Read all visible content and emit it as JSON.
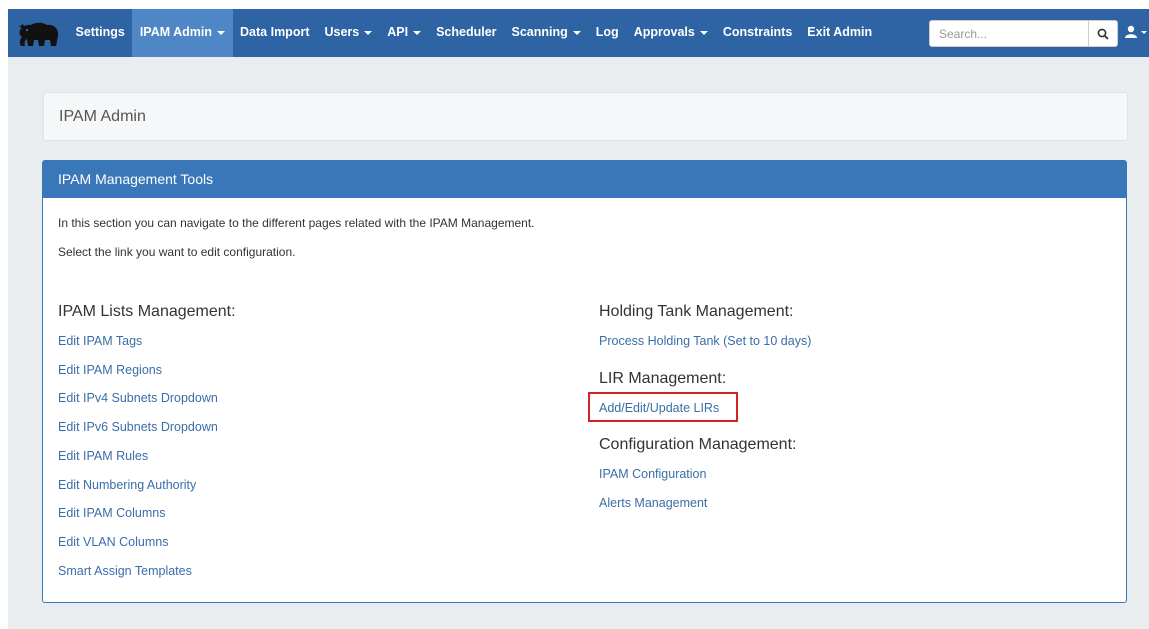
{
  "navbar": {
    "items": [
      {
        "label": "Settings",
        "dropdown": false
      },
      {
        "label": "IPAM Admin",
        "dropdown": true,
        "active": true
      },
      {
        "label": "Data Import",
        "dropdown": false
      },
      {
        "label": "Users",
        "dropdown": true
      },
      {
        "label": "API",
        "dropdown": true
      },
      {
        "label": "Scheduler",
        "dropdown": false
      },
      {
        "label": "Scanning",
        "dropdown": true
      },
      {
        "label": "Log",
        "dropdown": false
      },
      {
        "label": "Approvals",
        "dropdown": true
      },
      {
        "label": "Constraints",
        "dropdown": false
      },
      {
        "label": "Exit Admin",
        "dropdown": false
      }
    ],
    "search_placeholder": "Search...",
    "brand_color": "#2e63a4",
    "active_color": "#4f86c6"
  },
  "breadcrumb": {
    "title": "IPAM Admin"
  },
  "panel": {
    "heading": "IPAM Management Tools",
    "intro_1": "In this section you can navigate to the different pages related with the IPAM Management.",
    "intro_2": "Select the link you want to edit configuration.",
    "left": {
      "title": "IPAM Lists Management:",
      "links": [
        "Edit IPAM Tags",
        "Edit IPAM Regions",
        "Edit IPv4 Subnets Dropdown",
        "Edit IPv6 Subnets Dropdown",
        "Edit IPAM Rules",
        "Edit Numbering Authority",
        "Edit IPAM Columns",
        "Edit VLAN Columns",
        "Smart Assign Templates"
      ]
    },
    "right": {
      "holding_title": "Holding Tank Management:",
      "holding_link": "Process Holding Tank (Set to 10 days)",
      "lir_title": "LIR Management:",
      "lir_link": "Add/Edit/Update LIRs",
      "config_title": "Configuration Management:",
      "config_links": [
        "IPAM Configuration",
        "Alerts Management"
      ]
    },
    "highlight_color": "#d42328"
  }
}
